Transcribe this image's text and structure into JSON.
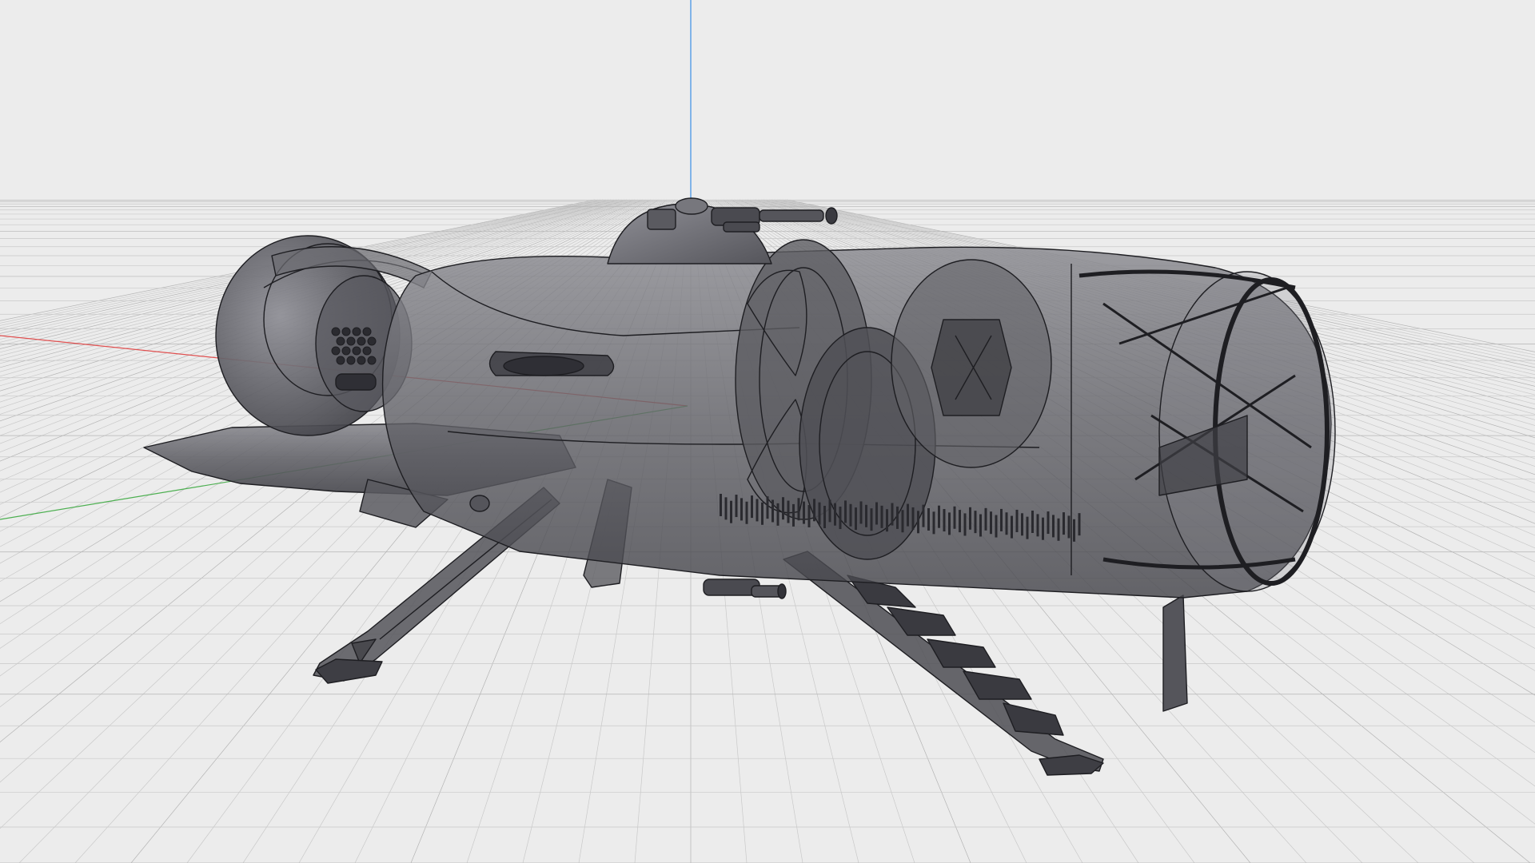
{
  "viewport": {
    "view": "perspective",
    "display_mode": "x-ray",
    "background_color": "#ececec",
    "grid_visible": true,
    "grid_color": "#c9c9c9",
    "grid_major_color": "#b4b4b4"
  },
  "axes": {
    "x_color": "#e05050",
    "y_color": "#4caf50",
    "z_color": "#3a8ee6"
  },
  "model": {
    "kind": "spaceship",
    "shade_color": "#6b6b70",
    "edge_color": "#1e1e22"
  }
}
